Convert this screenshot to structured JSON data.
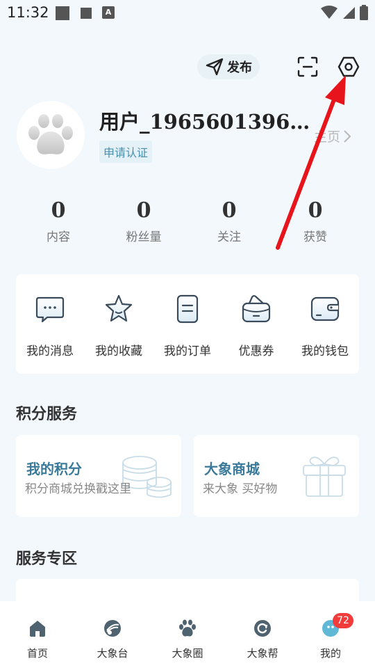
{
  "status_bar": {
    "time": "11:32",
    "notif_icon": "A"
  },
  "header": {
    "publish_label": "发布"
  },
  "profile": {
    "username": "用户_1965601396…",
    "verify_badge": "申请认证",
    "homepage_link": "主页",
    "stats": [
      {
        "value": "0",
        "label": "内容"
      },
      {
        "value": "0",
        "label": "粉丝量"
      },
      {
        "value": "0",
        "label": "关注"
      },
      {
        "value": "0",
        "label": "获赞"
      }
    ]
  },
  "menu": {
    "items": [
      {
        "label": "我的消息",
        "icon": "message-icon"
      },
      {
        "label": "我的收藏",
        "icon": "star-icon"
      },
      {
        "label": "我的订单",
        "icon": "order-icon"
      },
      {
        "label": "优惠券",
        "icon": "coupon-icon"
      },
      {
        "label": "我的钱包",
        "icon": "wallet-icon"
      }
    ]
  },
  "points_section": {
    "title": "积分服务",
    "cards": [
      {
        "title": "我的积分",
        "subtitle": "积分商城兑换戳这里"
      },
      {
        "title": "大象商城",
        "subtitle": "来大象  买好物"
      }
    ]
  },
  "service_section": {
    "title": "服务专区"
  },
  "bottom_nav": {
    "items": [
      {
        "label": "首页"
      },
      {
        "label": "大象台"
      },
      {
        "label": "大象圈"
      },
      {
        "label": "大象帮"
      },
      {
        "label": "我的"
      }
    ],
    "badge_count": "72"
  },
  "colors": {
    "background": "#f3f8fd",
    "accent_blue": "#3b7a9a",
    "badge_red": "#f23b3b",
    "annotation_arrow": "#e8141c"
  }
}
